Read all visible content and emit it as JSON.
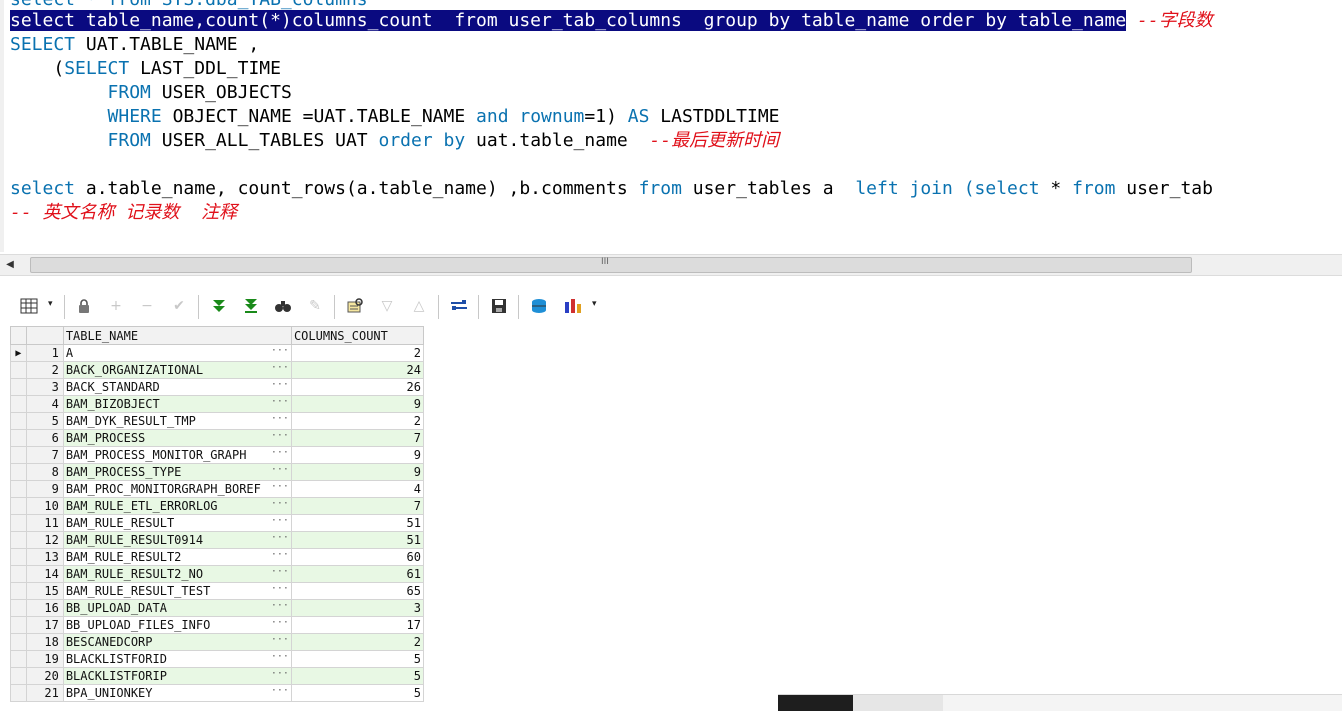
{
  "editor": {
    "line0_clipped": "select * from SYS.dba_TAB_columns",
    "line1": {
      "selected": "select table_name,count(*)columns_count  from user_tab_columns  group by table_name order by table_name",
      "comment": "--字段数"
    },
    "line2": {
      "kw": "SELECT",
      "rest": " UAT.TABLE_NAME ,"
    },
    "line3": {
      "indent": "    ",
      "paren": "(",
      "kw": "SELECT",
      "rest": " LAST_DDL_TIME"
    },
    "line4": {
      "indent": "         ",
      "kw": "FROM",
      "rest": " USER_OBJECTS"
    },
    "line5": {
      "indent": "         ",
      "kw1": "WHERE",
      "rest1": " OBJECT_NAME =UAT.TABLE_NAME ",
      "kw2": "and",
      "sp": " ",
      "kw3": "rownum",
      "rest2": "=1) ",
      "kw4": "AS",
      "rest3": " LASTDDLTIME"
    },
    "line6": {
      "indent": "         ",
      "kw1": "FROM",
      "rest1": " USER_ALL_TABLES UAT ",
      "kw2": "order by",
      "rest2": " uat.table_name  ",
      "comment": "--最后更新时间"
    },
    "line8": {
      "kw1": "select",
      "rest1": " a.table_name, count_rows(a.table_name) ,b.comments ",
      "kw2": "from",
      "rest2": " user_tables a  ",
      "kw3": "left join",
      "sp": " ",
      "kw4": "(select",
      "rest3": " * ",
      "kw5": "from",
      "rest4": " user_tab"
    },
    "line9": {
      "comment": "-- 英文名称 记录数  注释"
    }
  },
  "scrollbar": {
    "left_arrow": "◀",
    "grip": "III"
  },
  "toolbar": {
    "icons": [
      "grid-view-icon",
      "dropdown-arrow-icon",
      "lock-icon",
      "add-record-icon",
      "delete-record-icon",
      "post-changes-icon",
      "fetch-next-icon",
      "fetch-last-icon",
      "find-icon",
      "clear-icon",
      "query-by-example-icon",
      "previous-icon",
      "next-icon",
      "refresh-icon",
      "save-icon",
      "export-icon",
      "chart-icon",
      "chart-dropdown-icon"
    ],
    "glyphs": {
      "grid": "▦",
      "dropdown": "▾",
      "lock": "🔒",
      "add": "+",
      "delete": "−",
      "check": "✔",
      "fetch_next": "▼",
      "fetch_last": "⏬",
      "find": "⚲",
      "clear": "✎",
      "qbe": "⌸",
      "prev": "▽",
      "next": "△",
      "refresh": "⇶",
      "save": "💾",
      "export": "⛁",
      "chart": "▮▮",
      "chart_dd": "▾"
    }
  },
  "grid": {
    "columns": [
      "TABLE_NAME",
      "COLUMNS_COUNT"
    ],
    "current_row_marker": "▶",
    "ellipsis": "···",
    "rows": [
      {
        "n": "1",
        "name": "A",
        "count": "2"
      },
      {
        "n": "2",
        "name": "BACK_ORGANIZATIONAL",
        "count": "24"
      },
      {
        "n": "3",
        "name": "BACK_STANDARD",
        "count": "26"
      },
      {
        "n": "4",
        "name": "BAM_BIZOBJECT",
        "count": "9"
      },
      {
        "n": "5",
        "name": "BAM_DYK_RESULT_TMP",
        "count": "2"
      },
      {
        "n": "6",
        "name": "BAM_PROCESS",
        "count": "7"
      },
      {
        "n": "7",
        "name": "BAM_PROCESS_MONITOR_GRAPH",
        "count": "9"
      },
      {
        "n": "8",
        "name": "BAM_PROCESS_TYPE",
        "count": "9"
      },
      {
        "n": "9",
        "name": "BAM_PROC_MONITORGRAPH_BOREF",
        "count": "4"
      },
      {
        "n": "10",
        "name": "BAM_RULE_ETL_ERRORLOG",
        "count": "7"
      },
      {
        "n": "11",
        "name": "BAM_RULE_RESULT",
        "count": "51"
      },
      {
        "n": "12",
        "name": "BAM_RULE_RESULT0914",
        "count": "51"
      },
      {
        "n": "13",
        "name": "BAM_RULE_RESULT2",
        "count": "60"
      },
      {
        "n": "14",
        "name": "BAM_RULE_RESULT2_NO",
        "count": "61"
      },
      {
        "n": "15",
        "name": "BAM_RULE_RESULT_TEST",
        "count": "65"
      },
      {
        "n": "16",
        "name": "BB_UPLOAD_DATA",
        "count": "3"
      },
      {
        "n": "17",
        "name": "BB_UPLOAD_FILES_INFO",
        "count": "17"
      },
      {
        "n": "18",
        "name": "BESCANEDCORP",
        "count": "2"
      },
      {
        "n": "19",
        "name": "BLACKLISTFORID",
        "count": "5"
      },
      {
        "n": "20",
        "name": "BLACKLISTFORIP",
        "count": "5"
      },
      {
        "n": "21",
        "name": "BPA_UNIONKEY",
        "count": "5"
      }
    ]
  },
  "colors": {
    "keyword": "#0a72b0",
    "comment": "#e0101a",
    "selection_bg": "#0a0a80",
    "alt_row": "#e8f8e4"
  }
}
